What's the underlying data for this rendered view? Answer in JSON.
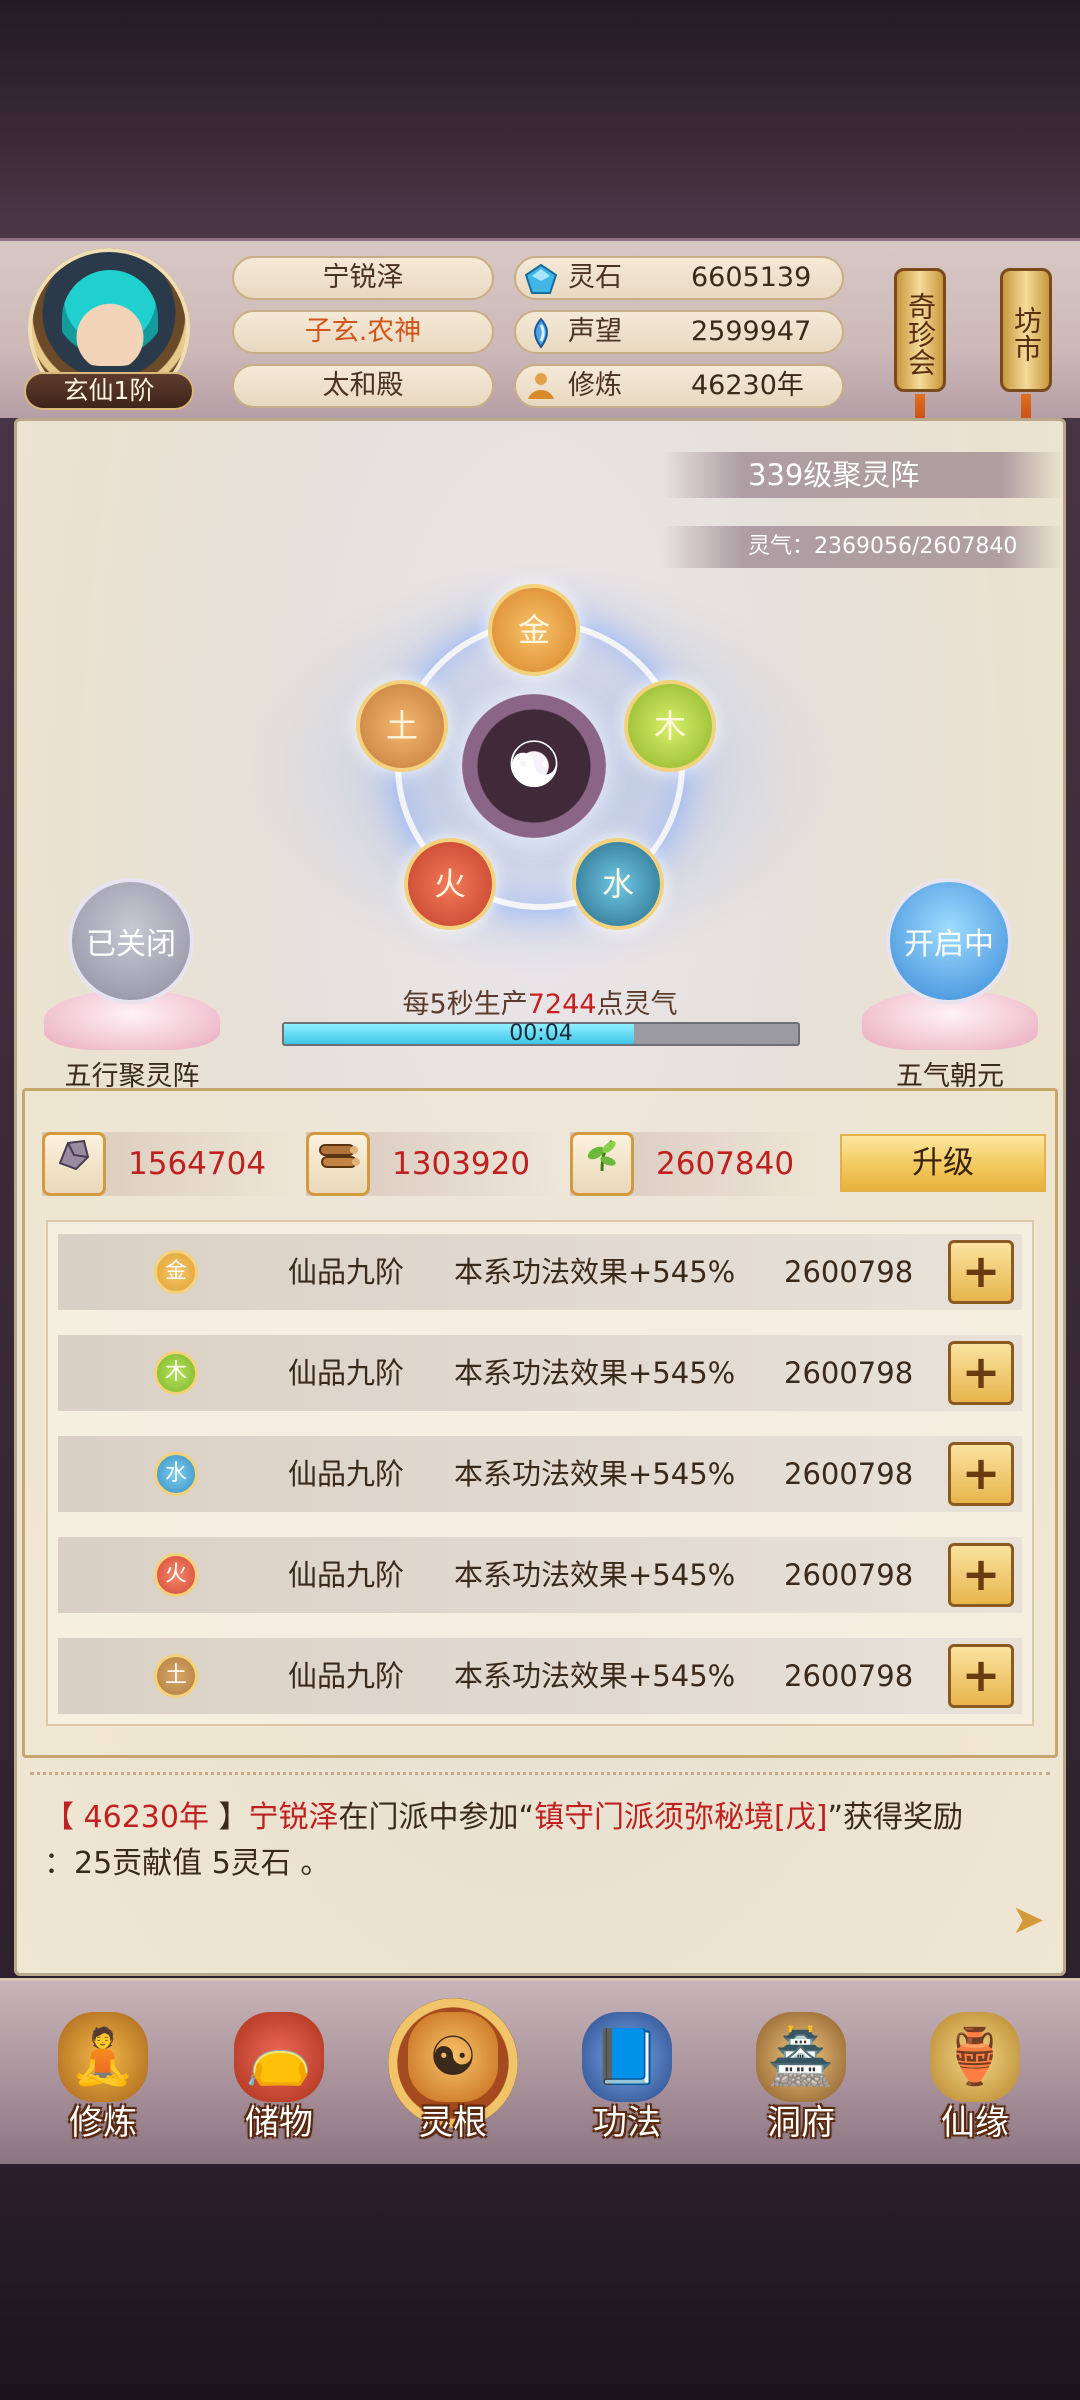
{
  "player": {
    "rank": "玄仙1阶",
    "name": "宁锐泽",
    "title": "子玄.农神",
    "hall": "太和殿"
  },
  "resources": [
    {
      "label": "灵石",
      "value": "6605139",
      "icon": "spirit-stone-icon"
    },
    {
      "label": "声望",
      "value": "2599947",
      "icon": "reputation-icon"
    },
    {
      "label": "修炼",
      "value": "46230年",
      "icon": "cultivation-icon"
    }
  ],
  "side_buttons": {
    "treasure_fair": "奇珍会",
    "market": "坊市"
  },
  "formation": {
    "level": "339级聚灵阵",
    "spirit_qi": "灵气：2369056/2607840",
    "elements": {
      "metal": "金",
      "wood": "木",
      "water": "水",
      "fire": "火",
      "earth": "土"
    },
    "left_toggle": {
      "state": "已关闭",
      "label": "五行聚灵阵"
    },
    "right_toggle": {
      "state": "开启中",
      "label": "五气朝元"
    },
    "produce_prefix": "每5秒生产",
    "produce_amount": "7244",
    "produce_suffix": "点灵气",
    "timer": "00:04",
    "progress": 0.68
  },
  "materials": [
    {
      "value": "1564704",
      "icon": "ore-icon"
    },
    {
      "value": "1303920",
      "icon": "wood-logs-icon"
    },
    {
      "value": "2607840",
      "icon": "herb-icon"
    }
  ],
  "upgrade_label": "升级",
  "element_rows": [
    {
      "element": "金",
      "grade": "仙品九阶",
      "effect": "本系功法效果+545%",
      "cost": "2600798",
      "color": "#e0a033"
    },
    {
      "element": "木",
      "grade": "仙品九阶",
      "effect": "本系功法效果+545%",
      "cost": "2600798",
      "color": "#7bb42c"
    },
    {
      "element": "水",
      "grade": "仙品九阶",
      "effect": "本系功法效果+545%",
      "cost": "2600798",
      "color": "#3a8fc0"
    },
    {
      "element": "火",
      "grade": "仙品九阶",
      "effect": "本系功法效果+545%",
      "cost": "2600798",
      "color": "#d9483a"
    },
    {
      "element": "土",
      "grade": "仙品九阶",
      "effect": "本系功法效果+545%",
      "cost": "2600798",
      "color": "#b08040"
    }
  ],
  "log": {
    "bracket_open": "【",
    "year": " 46230年 ",
    "bracket_close": "】",
    "name": "宁锐泽",
    "text1": "在门派中参加“",
    "event": "镇守门派须弥秘境[戊]",
    "text2": "”获得奖励",
    "line2": "：25贡献值 5灵石 。"
  },
  "nav": [
    {
      "label": "修炼",
      "icon": "cultivate-icon"
    },
    {
      "label": "储物",
      "icon": "storage-bag-icon"
    },
    {
      "label": "灵根",
      "icon": "spirit-root-icon"
    },
    {
      "label": "功法",
      "icon": "scripture-book-icon"
    },
    {
      "label": "洞府",
      "icon": "cave-house-icon"
    },
    {
      "label": "仙缘",
      "icon": "fate-gourd-icon"
    }
  ],
  "colors": {
    "accent_red": "#c02020",
    "gold": "#f2c659",
    "progress_cyan": "#3fc6e8"
  }
}
